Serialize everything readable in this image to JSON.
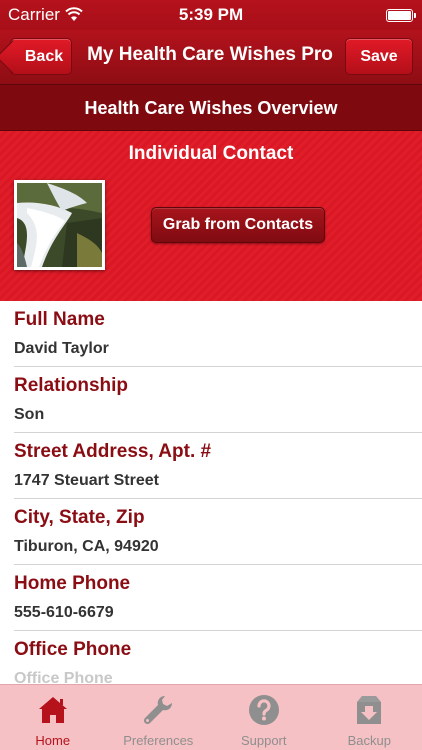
{
  "status_bar": {
    "carrier": "Carrier",
    "time": "5:39 PM"
  },
  "nav": {
    "back_label": "Back",
    "title": "My Health Care Wishes Pro",
    "save_label": "Save"
  },
  "overview_title": "Health Care Wishes Overview",
  "contact": {
    "section_title": "Individual Contact",
    "grab_label": "Grab from Contacts"
  },
  "fields": [
    {
      "label": "Full Name",
      "value": "David Taylor"
    },
    {
      "label": "Relationship",
      "value": "Son"
    },
    {
      "label": "Street Address, Apt. #",
      "value": "1747 Steuart Street"
    },
    {
      "label": "City, State, Zip",
      "value": "Tiburon, CA, 94920"
    },
    {
      "label": "Home Phone",
      "value": "555-610-6679"
    },
    {
      "label": "Office Phone",
      "placeholder": "Office Phone"
    }
  ],
  "tabs": [
    {
      "label": "Home",
      "icon": "home-icon",
      "active": true
    },
    {
      "label": "Preferences",
      "icon": "wrench-icon"
    },
    {
      "label": "Support",
      "icon": "question-icon"
    },
    {
      "label": "Backup",
      "icon": "box-icon"
    }
  ],
  "colors": {
    "primary_red": "#b5121c",
    "dark_red": "#7e0a10",
    "label_red": "#8b0d14",
    "tab_bg": "#f5c1c4"
  }
}
